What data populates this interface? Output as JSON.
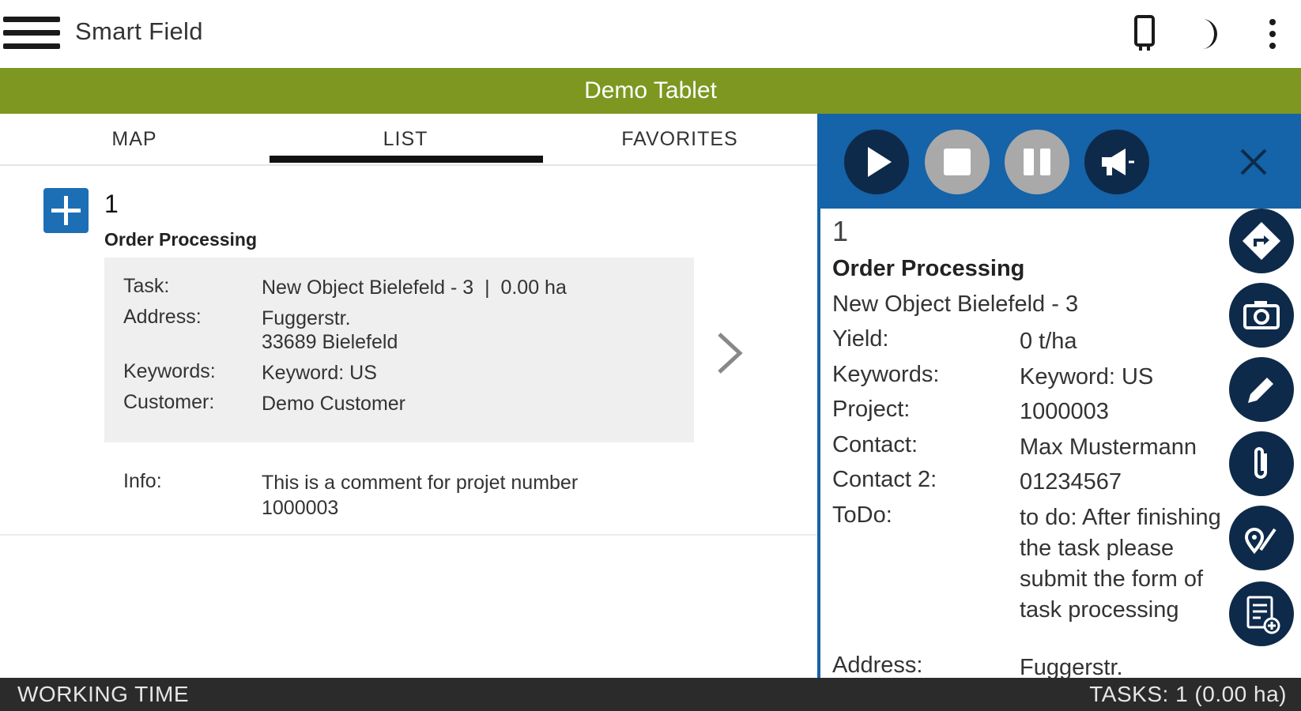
{
  "appbar": {
    "title": "Smart Field",
    "icons": [
      "menu-icon",
      "tablet-icon",
      "moon-icon",
      "more-vert-icon"
    ]
  },
  "banner": {
    "text": "Demo Tablet"
  },
  "tabs": [
    {
      "label": "MAP",
      "selected": false
    },
    {
      "label": "LIST",
      "selected": true
    },
    {
      "label": "FAVORITES",
      "selected": false
    }
  ],
  "card": {
    "number": "1",
    "title": "Order Processing",
    "task_label": "Task:",
    "task_value": "New Object Bielefeld - 3  |  0.00 ha",
    "address_label": "Address:",
    "address_line1": "Fuggerstr.",
    "address_line2": "33689 Bielefeld",
    "keywords_label": "Keywords:",
    "keywords_value": "Keyword: US",
    "customer_label": "Customer:",
    "customer_value": "Demo Customer",
    "info_label": "Info:",
    "info_value": "This is a comment for projet number 1000003"
  },
  "detail": {
    "number": "1",
    "title": "Order Processing",
    "subtitle": "New Object Bielefeld - 3",
    "yield_label": "Yield:",
    "yield_value": "0 t/ha",
    "keywords_label": "Keywords:",
    "keywords_value": "Keyword: US",
    "project_label": "Project:",
    "project_value": "1000003",
    "contact_label": "Contact:",
    "contact_value": "Max Mustermann",
    "contact2_label": "Contact 2:",
    "contact2_value": "01234567",
    "todo_label": "ToDo:",
    "todo_value": "to do: After finishing the task please submit the form of task processing",
    "address_label": "Address:",
    "address_value": "Fuggerstr."
  },
  "controls": [
    "play-icon",
    "stop-icon",
    "pause-icon",
    "megaphone-icon",
    "close-icon"
  ],
  "fabs": [
    "navigate-icon",
    "camera-icon",
    "pencil-icon",
    "paperclip-icon",
    "map-pin-route-icon",
    "form-add-icon"
  ],
  "bottom": {
    "left": "WORKING TIME",
    "right": "TASKS: 1 (0.00 ha)"
  },
  "colors": {
    "banner": "#7d9720",
    "accent_blue": "#1563a8",
    "dark_navy": "#0e2a4a",
    "disabled_gray": "#a9a9a9",
    "bottom_bar": "#2b2b2b"
  }
}
